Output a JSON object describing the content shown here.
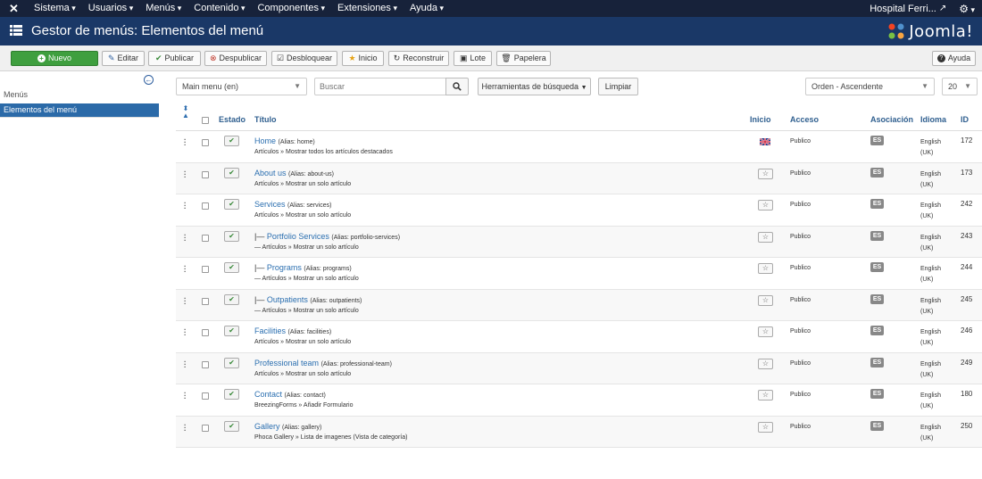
{
  "topnav": {
    "items": [
      "Sistema",
      "Usuarios",
      "Menús",
      "Contenido",
      "Componentes",
      "Extensiones",
      "Ayuda"
    ],
    "site_name": "Hospital Ferri...",
    "external_glyph": "↗",
    "settings_glyph": "⚙"
  },
  "header": {
    "title": "Gestor de menús: Elementos del menú",
    "brand": "Joomla!"
  },
  "toolbar": {
    "new": "Nuevo",
    "edit": "Editar",
    "publish": "Publicar",
    "unpublish": "Despublicar",
    "unlock": "Desbloquear",
    "home": "Inicio",
    "rebuild": "Reconstruir",
    "batch": "Lote",
    "trash": "Papelera",
    "help": "Ayuda"
  },
  "sidebar": {
    "heading": "Menús",
    "active_item": "Elementos del menú"
  },
  "filters": {
    "menu": "Main menu (en)",
    "search_placeholder": "Buscar",
    "tools": "Herramientas de búsqueda",
    "clear": "Limpiar",
    "order": "Orden - Ascendente",
    "limit": "20"
  },
  "table": {
    "headers": {
      "status": "Estado",
      "title": "Título",
      "home": "Inicio",
      "access": "Acceso",
      "association": "Asociación",
      "language": "Idioma",
      "id": "ID"
    },
    "rows": [
      {
        "prefix": "",
        "title": "Home",
        "alias": "(Alias: home)",
        "sub": "Artículos » Mostrar todos los artículos destacados",
        "home_flag": true,
        "access": "Publico",
        "lang_badge": "ES",
        "language": "English (UK)",
        "id": "172"
      },
      {
        "prefix": "",
        "title": "About us",
        "alias": "(Alias: about-us)",
        "sub": "Artículos » Mostrar un solo artículo",
        "home_flag": false,
        "access": "Publico",
        "lang_badge": "ES",
        "language": "English (UK)",
        "id": "173"
      },
      {
        "prefix": "",
        "title": "Services",
        "alias": "(Alias: services)",
        "sub": "Artículos » Mostrar un solo artículo",
        "home_flag": false,
        "access": "Publico",
        "lang_badge": "ES",
        "language": "English (UK)",
        "id": "242"
      },
      {
        "prefix": "|— ",
        "title": "Portfolio Services",
        "alias": "(Alias: portfolio-services)",
        "sub": "— Artículos » Mostrar un solo artículo",
        "home_flag": false,
        "access": "Publico",
        "lang_badge": "ES",
        "language": "English (UK)",
        "id": "243"
      },
      {
        "prefix": "|— ",
        "title": "Programs",
        "alias": "(Alias: programs)",
        "sub": "— Artículos » Mostrar un solo artículo",
        "home_flag": false,
        "access": "Publico",
        "lang_badge": "ES",
        "language": "English (UK)",
        "id": "244"
      },
      {
        "prefix": "|— ",
        "title": "Outpatients",
        "alias": "(Alias: outpatients)",
        "sub": "— Artículos » Mostrar un solo artículo",
        "home_flag": false,
        "access": "Publico",
        "lang_badge": "ES",
        "language": "English (UK)",
        "id": "245"
      },
      {
        "prefix": "",
        "title": "Facilities",
        "alias": "(Alias: facilities)",
        "sub": "Artículos » Mostrar un solo artículo",
        "home_flag": false,
        "access": "Publico",
        "lang_badge": "ES",
        "language": "English (UK)",
        "id": "246"
      },
      {
        "prefix": "",
        "title": "Professional team",
        "alias": "(Alias: professional-team)",
        "sub": "Artículos » Mostrar un solo artículo",
        "home_flag": false,
        "access": "Publico",
        "lang_badge": "ES",
        "language": "English (UK)",
        "id": "249"
      },
      {
        "prefix": "",
        "title": "Contact",
        "alias": "(Alias: contact)",
        "sub": "BreezingForms » Añadir Formulario",
        "home_flag": false,
        "access": "Publico",
        "lang_badge": "ES",
        "language": "English (UK)",
        "id": "180"
      },
      {
        "prefix": "",
        "title": "Gallery",
        "alias": "(Alias: gallery)",
        "sub": "Phoca Gallery » Lista de imagenes (Vista de categoría)",
        "home_flag": false,
        "access": "Publico",
        "lang_badge": "ES",
        "language": "English (UK)",
        "id": "250"
      }
    ]
  },
  "colors": {
    "topnav_bg": "#17223a",
    "header_bg": "#1a3867",
    "new_button": "#3f9f3f",
    "sidebar_active": "#2b6aa8",
    "link": "#2b6fb0"
  }
}
